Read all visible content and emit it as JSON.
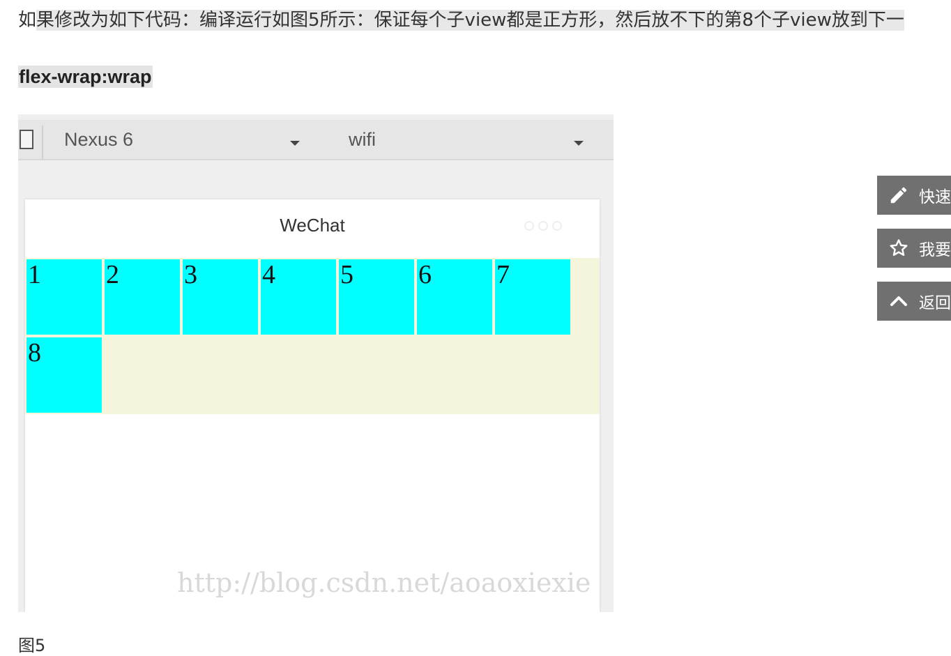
{
  "article": {
    "intro_lead": "如",
    "intro_rest": "果修改为如下代码：编译运行如图5所示：保证每个子view都是正方形，然后放不下的第8个子view放到下一",
    "heading": "flex-wrap:wrap",
    "figure_caption": "图5"
  },
  "simulator": {
    "device": "Nexus 6",
    "network": "wifi",
    "nav_title": "WeChat",
    "items": [
      "1",
      "2",
      "3",
      "4",
      "5",
      "6",
      "7",
      "8"
    ],
    "watermark": "http://blog.csdn.net/aoaoxiexie"
  },
  "side_buttons": [
    {
      "icon": "pencil-icon",
      "label": "快速"
    },
    {
      "icon": "star-icon",
      "label": "我要"
    },
    {
      "icon": "chevron-up-icon",
      "label": "返回"
    }
  ],
  "colors": {
    "cell": "#00ffff",
    "container": "#f5f5dc",
    "side_button": "#707070"
  }
}
